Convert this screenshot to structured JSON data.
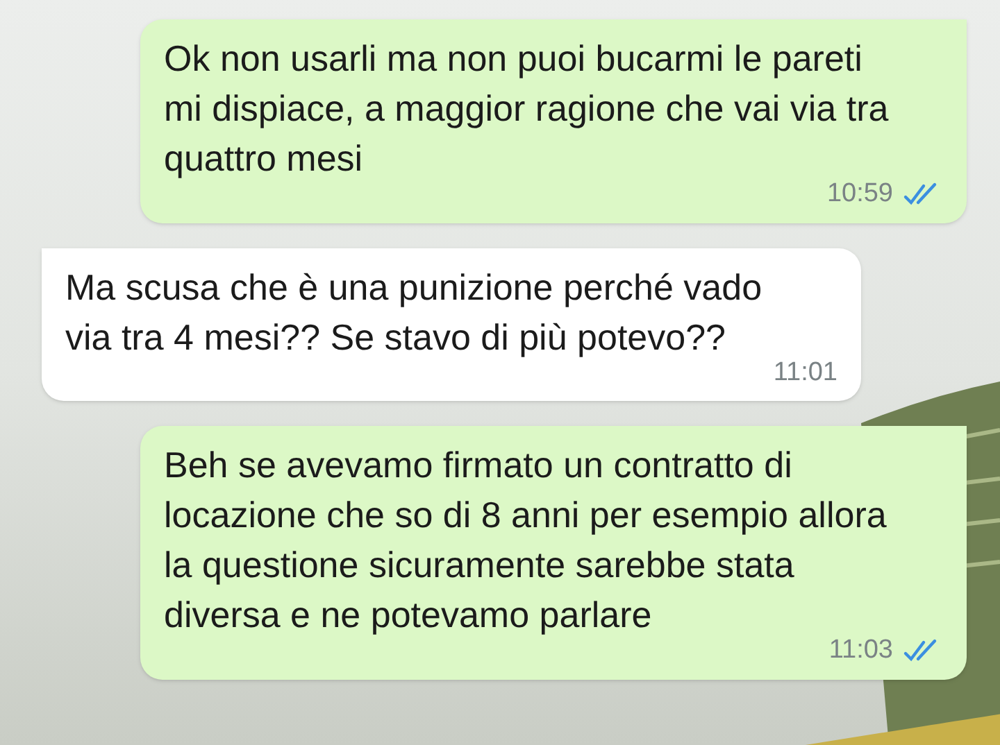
{
  "messages": [
    {
      "outgoing": true,
      "text": "Ok non usarli ma non puoi bucarmi le pareti mi dispiace, a maggior ragione che vai via tra quattro mesi",
      "time": "10:59",
      "read": true
    },
    {
      "outgoing": false,
      "text": "Ma scusa che è una punizione perché vado via tra 4 mesi?? Se stavo di più potevo??",
      "time": "11:01"
    },
    {
      "outgoing": true,
      "text": "Beh se avevamo firmato un contratto di locazione che so di 8 anni per esempio allora la questione sicuramente sarebbe stata diversa e ne potevamo parlare",
      "time": "11:03",
      "read": true
    }
  ]
}
